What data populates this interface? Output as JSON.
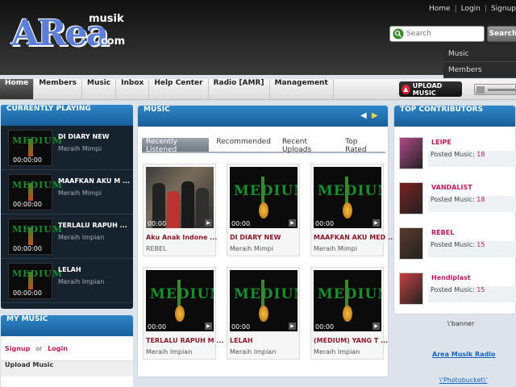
{
  "logo": {
    "main": "ARea",
    "musik": "musik",
    "com": ".com"
  },
  "toplinks": [
    "Home",
    "Login",
    "Signup"
  ],
  "search": {
    "placeholder": "Search",
    "button": "Search"
  },
  "dropdown": [
    "Music",
    "Members"
  ],
  "nav": [
    "Home",
    "Members",
    "Music",
    "Inbox",
    "Help Center",
    "Radio [AMR]",
    "Management"
  ],
  "upload_btn": "UPLOAD MUSIC",
  "now_playing": {
    "title": "CURRENTLY PLAYING",
    "items": [
      {
        "title": "DI DIARY NEW",
        "sub": "Meraih Mimpi",
        "time": "00:00:00"
      },
      {
        "title": "MAAFKAN AKU M ...",
        "sub": "Meraih Mimpi",
        "time": "00:00:00"
      },
      {
        "title": "TERLALU RAPUH ...",
        "sub": "Meraih Impian",
        "time": "00:00:00"
      },
      {
        "title": "LELAH",
        "sub": "Meraih Impian",
        "time": "00:00:00"
      }
    ]
  },
  "my_music": {
    "title": "MY MUSIC",
    "signup": "Signup",
    "or": "or",
    "login": "Login",
    "upload": "Upload Music"
  },
  "music": {
    "title": "MUSIC",
    "tabs": [
      "Recently Listened",
      "Recommended",
      "Recent Uploads",
      "Top Rated"
    ],
    "cards": [
      {
        "title": "Aku Anak Indone ...",
        "sub": "REBEL",
        "time": "00:00",
        "kind": "band"
      },
      {
        "title": "DI DIARY NEW",
        "sub": "Meraih Mimpi",
        "time": "00:00",
        "kind": "medium"
      },
      {
        "title": "MAAFKAN AKU MED ...",
        "sub": "Meraih Mimpi",
        "time": "00:00",
        "kind": "medium"
      },
      {
        "title": "TERLALU RAPUH M ...",
        "sub": "Meraih Impian",
        "time": "00:00",
        "kind": "medium"
      },
      {
        "title": "LELAH",
        "sub": "Meraih Impian",
        "time": "00:00",
        "kind": "medium"
      },
      {
        "title": "(MEDIUM) YANG T ...",
        "sub": "Meraih Impian",
        "time": "00:00",
        "kind": "medium"
      }
    ],
    "medium_logo": "MEDIUM"
  },
  "contributors": {
    "title": "TOP CONTRIBUTORS",
    "posted_label": "Posted Music:",
    "items": [
      {
        "name": "LEIPE",
        "count": "18",
        "color": "#b04a8a"
      },
      {
        "name": "VANDALIST",
        "count": "18",
        "color": "#7a2020"
      },
      {
        "name": "REBEL",
        "count": "15",
        "color": "#5a3a2a"
      },
      {
        "name": "Hendiplast",
        "count": "15",
        "color": "#c94040"
      }
    ]
  },
  "banner": "\\'banner",
  "radio_link": "Area Musik Radio",
  "photo_link": "\\'Photobucket\\'"
}
